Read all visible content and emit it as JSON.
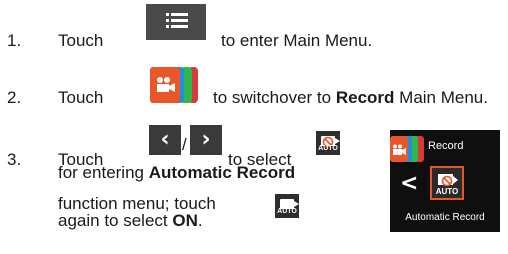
{
  "steps": [
    {
      "number": "1.",
      "parts": [
        "Touch",
        "to enter Main Menu."
      ]
    },
    {
      "number": "2.",
      "parts": [
        "Touch",
        "to switchover to",
        "Record",
        "Main Menu."
      ]
    },
    {
      "number": "3.",
      "parts": [
        "Touch",
        "/",
        "to select",
        "for entering",
        "Automatic Record",
        "function menu; touch",
        "again to select",
        "ON",
        "."
      ]
    }
  ],
  "icons": {
    "menu": "list-icon",
    "record_tab": "record-tab-icon",
    "prev": "chevron-left-icon",
    "next": "chevron-right-icon",
    "auto_record": "auto-record-icon",
    "auto_label": "AUTO"
  },
  "colors": {
    "accent": "#e8562a",
    "tab_blue": "#1e8fe0",
    "tab_green": "#2fb84a",
    "tab_red": "#d63a3a",
    "dark": "#3a3a3a"
  },
  "panel": {
    "tab_label": "Record",
    "chevron": "<",
    "icon_label": "AUTO",
    "caption": "Automatic Record"
  }
}
